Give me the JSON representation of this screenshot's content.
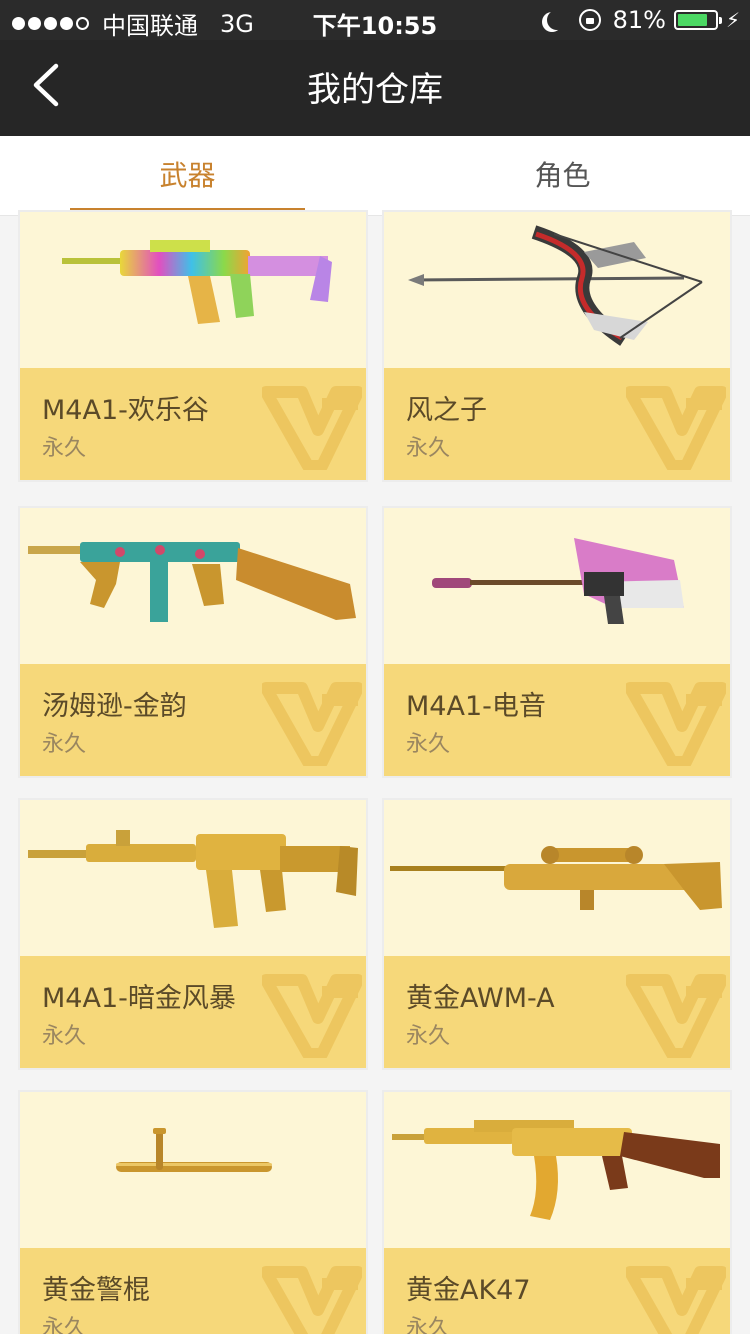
{
  "status_bar": {
    "carrier": "中国联通",
    "network": "3G",
    "time": "下午10:55",
    "battery_percent": "81%",
    "battery_level": 0.81
  },
  "nav": {
    "title": "我的仓库",
    "back_icon": "chevron-left-icon"
  },
  "tabs": [
    {
      "label": "武器",
      "active": true
    },
    {
      "label": "角色",
      "active": false
    }
  ],
  "colors": {
    "accent": "#c8822e",
    "card_bg": "#fdf6d6",
    "card_info_bg": "#f6d87a",
    "nav_bg": "#262626"
  },
  "items": [
    {
      "name": "M4A1-欢乐谷",
      "duration": "永久",
      "icon": "rifle-colorful-icon"
    },
    {
      "name": "风之子",
      "duration": "永久",
      "icon": "bow-icon"
    },
    {
      "name": "汤姆逊-金韵",
      "duration": "永久",
      "icon": "tommy-gun-icon"
    },
    {
      "name": "M4A1-电音",
      "duration": "永久",
      "icon": "guitar-rifle-icon"
    },
    {
      "name": "M4A1-暗金风暴",
      "duration": "永久",
      "icon": "gold-rifle-icon"
    },
    {
      "name": "黄金AWM-A",
      "duration": "永久",
      "icon": "gold-sniper-icon"
    },
    {
      "name": "黄金警棍",
      "duration": "永久",
      "icon": "gold-baton-icon"
    },
    {
      "name": "黄金AK47",
      "duration": "永久",
      "icon": "gold-ak47-icon"
    }
  ]
}
